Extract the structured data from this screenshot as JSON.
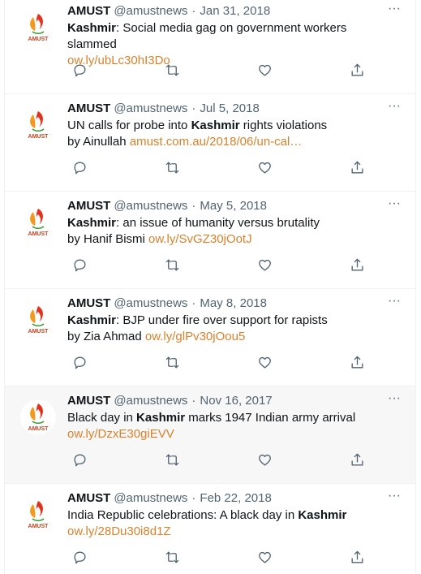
{
  "tweets": [
    {
      "name": "AMUST",
      "handle": "@amustnews",
      "separator": "·",
      "date": "Jan 31, 2018",
      "line1_bold": "Kashmir",
      "line1_rest": ": Social media gag on government workers slammed",
      "line2_text": "",
      "link": "ow.ly/ubLc30hI3Do"
    },
    {
      "name": "AMUST",
      "handle": "@amustnews",
      "separator": "·",
      "date": "Jul 5, 2018",
      "line1_pre": "UN calls for probe into ",
      "line1_bold": "Kashmir",
      "line1_rest": " rights violations",
      "line2_text": "by Ainullah ",
      "link": "amust.com.au/2018/06/un-cal…"
    },
    {
      "name": "AMUST",
      "handle": "@amustnews",
      "separator": "·",
      "date": "May 5, 2018",
      "line1_bold": "Kashmir",
      "line1_rest": ": an issue of humanity versus brutality",
      "line2_text": "by Hanif Bismi ",
      "link": "ow.ly/SvGZ30jOotJ"
    },
    {
      "name": "AMUST",
      "handle": "@amustnews",
      "separator": "·",
      "date": "May 8, 2018",
      "line1_bold": "Kashmir",
      "line1_rest": ": BJP under fire over support for rapists",
      "line2_text": "by Zia Ahmad ",
      "link": "ow.ly/glPv30jOou5"
    },
    {
      "name": "AMUST",
      "handle": "@amustnews",
      "separator": "·",
      "date": "Nov 16, 2017",
      "line1_pre": "Black day in ",
      "line1_bold": "Kashmir",
      "line1_rest": " marks 1947 Indian army arrival",
      "line2_text": "",
      "link": "ow.ly/DzxE30giEVV"
    },
    {
      "name": "AMUST",
      "handle": "@amustnews",
      "separator": "·",
      "date": "Feb 22, 2018",
      "line1_pre": "India Republic celebrations: A black day in ",
      "line1_bold": "Kashmir",
      "line1_rest": "",
      "line2_text": "",
      "link": "ow.ly/28Du30i8d1Z"
    }
  ],
  "more_glyph": "···",
  "logo_text": "AMUST",
  "colors": {
    "link": "#d9822b",
    "text": "#0f1419",
    "muted": "#536471",
    "logo_red": "#e0331e",
    "logo_orange": "#f39a1e",
    "logo_green": "#3a9a3a"
  },
  "icons": [
    "reply-icon",
    "retweet-icon",
    "like-icon",
    "share-icon",
    "more-icon"
  ]
}
